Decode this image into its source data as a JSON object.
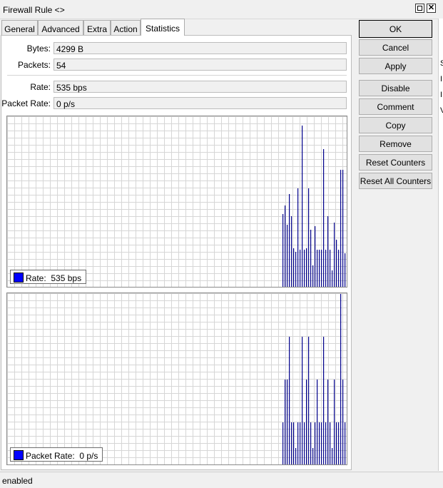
{
  "window": {
    "title": "Firewall Rule <>",
    "maximize_glyph": "",
    "close_glyph": "✕"
  },
  "tabs": [
    {
      "label": "General"
    },
    {
      "label": "Advanced"
    },
    {
      "label": "Extra"
    },
    {
      "label": "Action"
    },
    {
      "label": "Statistics",
      "active": true
    }
  ],
  "stats": {
    "bytes_label": "Bytes:",
    "bytes_value": "4299 B",
    "packets_label": "Packets:",
    "packets_value": "54",
    "rate_label": "Rate:",
    "rate_value": "535 bps",
    "packet_rate_label": "Packet Rate:",
    "packet_rate_value": "0 p/s"
  },
  "graphs": {
    "rate_legend_label": "Rate:",
    "rate_legend_value": "535 bps",
    "packet_rate_legend_label": "Packet Rate:",
    "packet_rate_legend_value": "0 p/s",
    "series_color": "#0000ff",
    "bar_color": "#00008b"
  },
  "chart_data": [
    {
      "type": "bar",
      "series": [
        {
          "name": "Rate",
          "values": [
            0.43,
            0.48,
            0.37,
            0.55,
            0.42,
            0.23,
            0.21,
            0.58,
            0.22,
            0.95,
            0.22,
            0.23,
            0.58,
            0.34,
            0.13,
            0.36,
            0.22,
            0.22,
            0.22,
            0.81,
            0.22,
            0.42,
            0.22,
            0.1,
            0.38,
            0.28,
            0.22,
            0.69,
            0.69,
            0.2,
            0.17
          ]
        }
      ]
    },
    {
      "type": "bar",
      "series": [
        {
          "name": "Packet Rate",
          "values": [
            0.25,
            0.5,
            0.5,
            0.75,
            0.25,
            0.25,
            0.1,
            0.25,
            0.25,
            0.75,
            0.25,
            0.5,
            0.75,
            0.25,
            0.1,
            0.25,
            0.5,
            0.25,
            0.25,
            0.75,
            0.25,
            0.5,
            0.25,
            0.1,
            0.5,
            0.25,
            0.25,
            1.0,
            0.5,
            0.25,
            0.75
          ]
        }
      ]
    }
  ],
  "buttons": {
    "ok": "OK",
    "cancel": "Cancel",
    "apply": "Apply",
    "disable": "Disable",
    "comment": "Comment",
    "copy": "Copy",
    "remove": "Remove",
    "reset_counters": "Reset Counters",
    "reset_all_counters": "Reset All Counters"
  },
  "side_edge": [
    "S",
    "I",
    "I",
    "V"
  ],
  "status": {
    "text": "enabled"
  }
}
